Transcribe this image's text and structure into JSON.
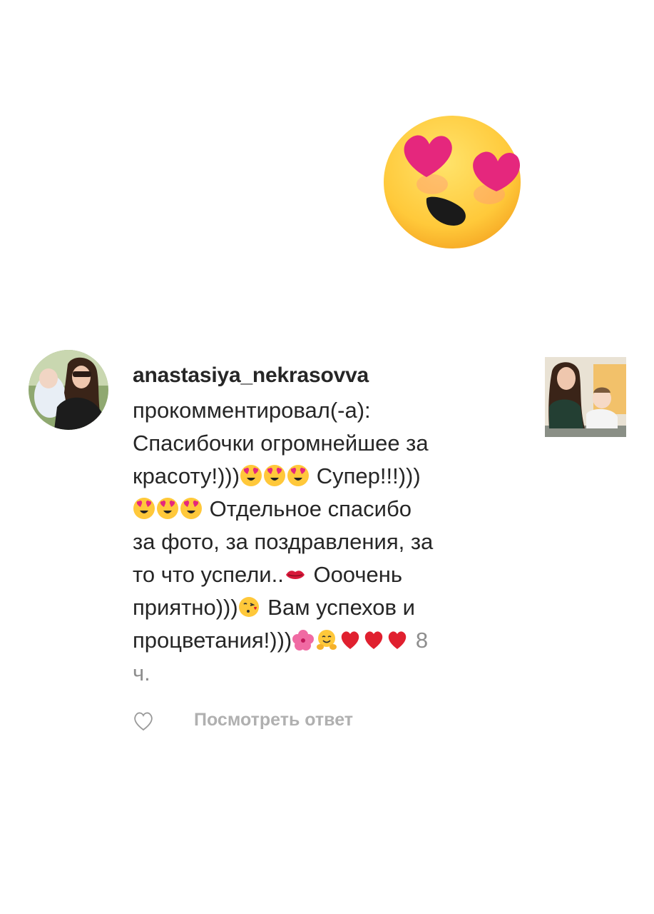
{
  "big_emoji": "smiling-face-with-heart-eyes",
  "notification": {
    "username": "anastasiya_nekrasovva",
    "action": "прокомментировал(-а):",
    "comment": {
      "line1": "Спасибочки огромнейшее за",
      "line2_text_a": "красоту!)))",
      "line2_text_b": " Супер!!!)))",
      "line3_text": " Отдельное спасибо",
      "line4": "за фото, за поздравления, за",
      "line5_text_a": "то что успели..",
      "line5_text_b": " Ооочень",
      "line6_text_a": "приятно)))",
      "line6_text_b": " Вам успехов и",
      "line7_text_a": "процветания!)))"
    },
    "time_a": " 8",
    "time_b": "ч.",
    "thumbnail": "post-thumbnail-photo",
    "avatar": "user-avatar-photo"
  },
  "actions": {
    "like_icon": "heart-outline-icon",
    "view_reply_label": "Посмотреть ответ"
  },
  "colors": {
    "text": "#262626",
    "muted": "#8e8e8e",
    "reply": "#b0b0b0",
    "heart": "#e0202f"
  }
}
